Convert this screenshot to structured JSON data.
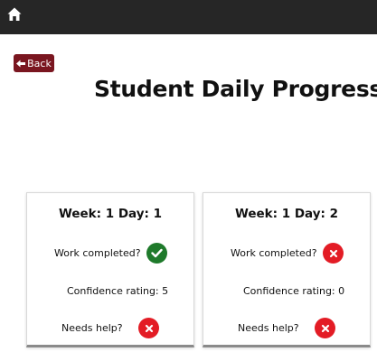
{
  "header": {
    "home_icon": "home-icon"
  },
  "nav": {
    "back_label": "Back",
    "back_icon": "arrow-left-icon"
  },
  "page": {
    "title": "Student Daily Progress"
  },
  "cards": [
    {
      "title": "Week: 1 Day: 1",
      "work_completed_label": "Work completed?",
      "work_completed": true,
      "work_completed_icon": "check-icon",
      "confidence_label": "Confidence rating: 5",
      "needs_help_label": "Needs help?",
      "needs_help": false,
      "needs_help_icon": "x-icon"
    },
    {
      "title": "Week: 1 Day: 2",
      "work_completed_label": "Work completed?",
      "work_completed": false,
      "work_completed_icon": "x-icon",
      "confidence_label": "Confidence rating: 0",
      "needs_help_label": "Needs help?",
      "needs_help": false,
      "needs_help_icon": "x-icon"
    }
  ],
  "colors": {
    "topbar": "#262626",
    "back_button": "#7a1620",
    "status_yes": "#1f7a2b",
    "status_no": "#e31c25"
  }
}
